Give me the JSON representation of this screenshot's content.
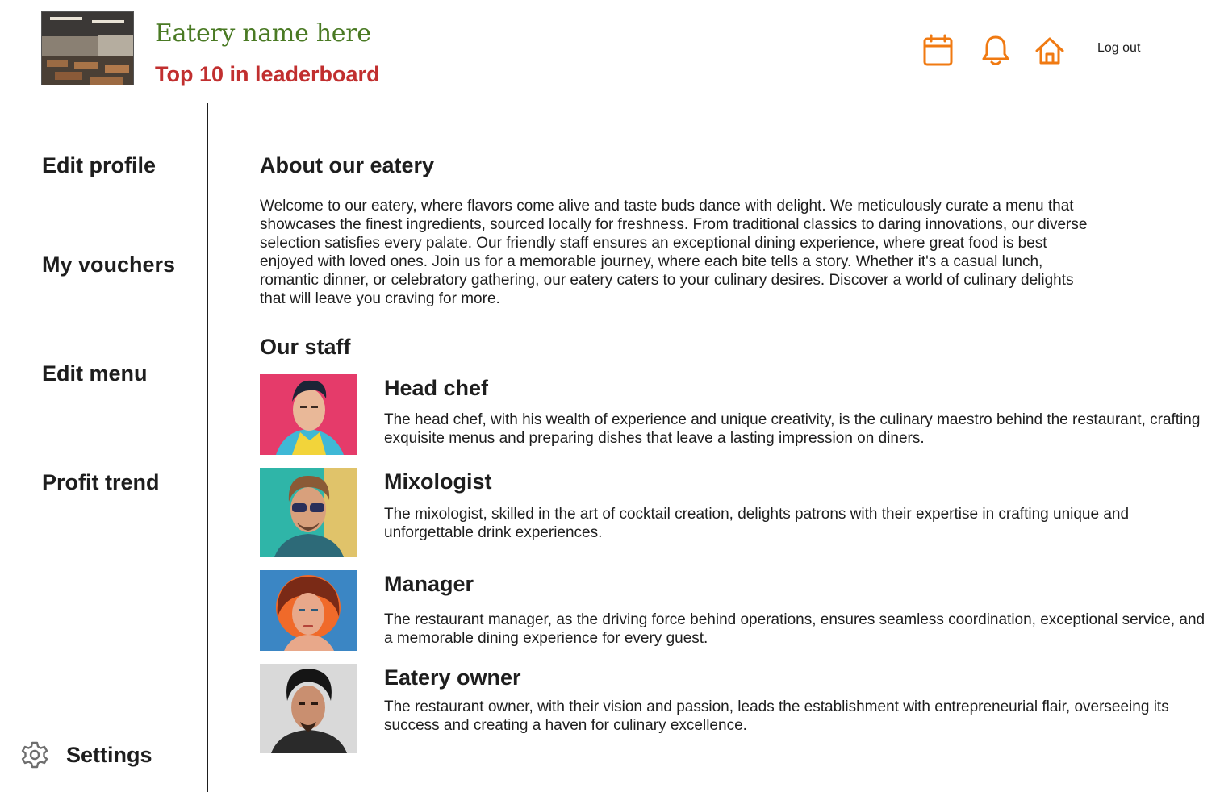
{
  "header": {
    "eatery_name": "Eatery name here",
    "rank_text": "Top 10 in leaderboard",
    "logout_label": "Log out",
    "icons": [
      "calendar-icon",
      "bell-icon",
      "home-icon"
    ],
    "accent_color": "#f07a12",
    "name_color": "#4a7a24",
    "rank_color": "#c12f2f"
  },
  "sidebar": {
    "items": [
      {
        "label": "Edit profile"
      },
      {
        "label": "My vouchers"
      },
      {
        "label": "Edit menu"
      },
      {
        "label": "Profit trend"
      }
    ],
    "settings_label": "Settings"
  },
  "about": {
    "title": "About our eatery",
    "text": "Welcome to our eatery, where flavors come alive and taste buds dance with delight. We meticulously curate a menu that showcases the finest ingredients, sourced locally for freshness. From traditional classics to daring innovations, our diverse selection satisfies every palate. Our friendly staff ensures an exceptional dining experience, where great food is best enjoyed with loved ones. Join us for a memorable journey, where each bite tells a story. Whether it's a casual lunch, romantic dinner, or celebratory gathering, our eatery caters to your culinary desires. Discover a world of culinary delights that will leave you craving for more."
  },
  "staff": {
    "title": "Our staff",
    "members": [
      {
        "role": "Head chef",
        "description": "The head chef, with his wealth of experience and unique creativity, is the culinary maestro behind the restaurant, crafting exquisite menus and preparing dishes that leave a lasting impression on diners."
      },
      {
        "role": "Mixologist",
        "description": "The mixologist, skilled in the art of cocktail creation, delights patrons with their expertise in crafting unique and unforgettable drink experiences."
      },
      {
        "role": "Manager",
        "description": "The restaurant manager, as the driving force behind operations, ensures seamless coordination, exceptional service, and a memorable dining experience for every guest."
      },
      {
        "role": "Eatery owner",
        "description": "The restaurant owner, with their vision and passion, leads the establishment with entrepreneurial flair, overseeing its success and creating a haven for culinary excellence."
      }
    ]
  }
}
